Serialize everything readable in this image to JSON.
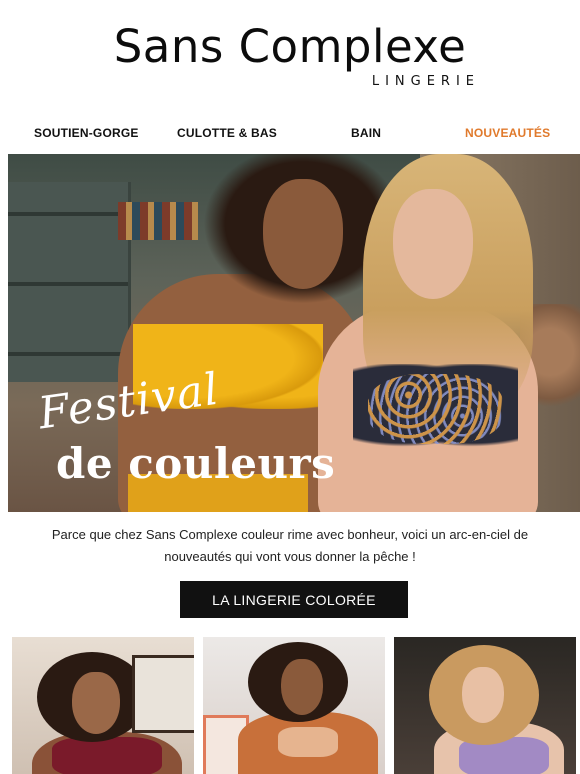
{
  "brand": {
    "name": "Sans Complexe",
    "subtitle": "LINGERIE"
  },
  "nav": [
    {
      "label": "SOUTIEN-GORGE"
    },
    {
      "label": "CULOTTE & BAS"
    },
    {
      "label": "BAIN"
    },
    {
      "label": "NOUVEAUTÉS"
    }
  ],
  "hero": {
    "script_title": "Festival",
    "title": "de couleurs"
  },
  "intro": "Parce que chez Sans Complexe couleur rime avec bonheur, voici un arc-en-ciel de nouveautés qui vont vous donner la pêche !",
  "cta": {
    "label": "LA LINGERIE COLORÉE"
  },
  "colors": {
    "accent": "#e07a2c",
    "button_bg": "#111111"
  }
}
